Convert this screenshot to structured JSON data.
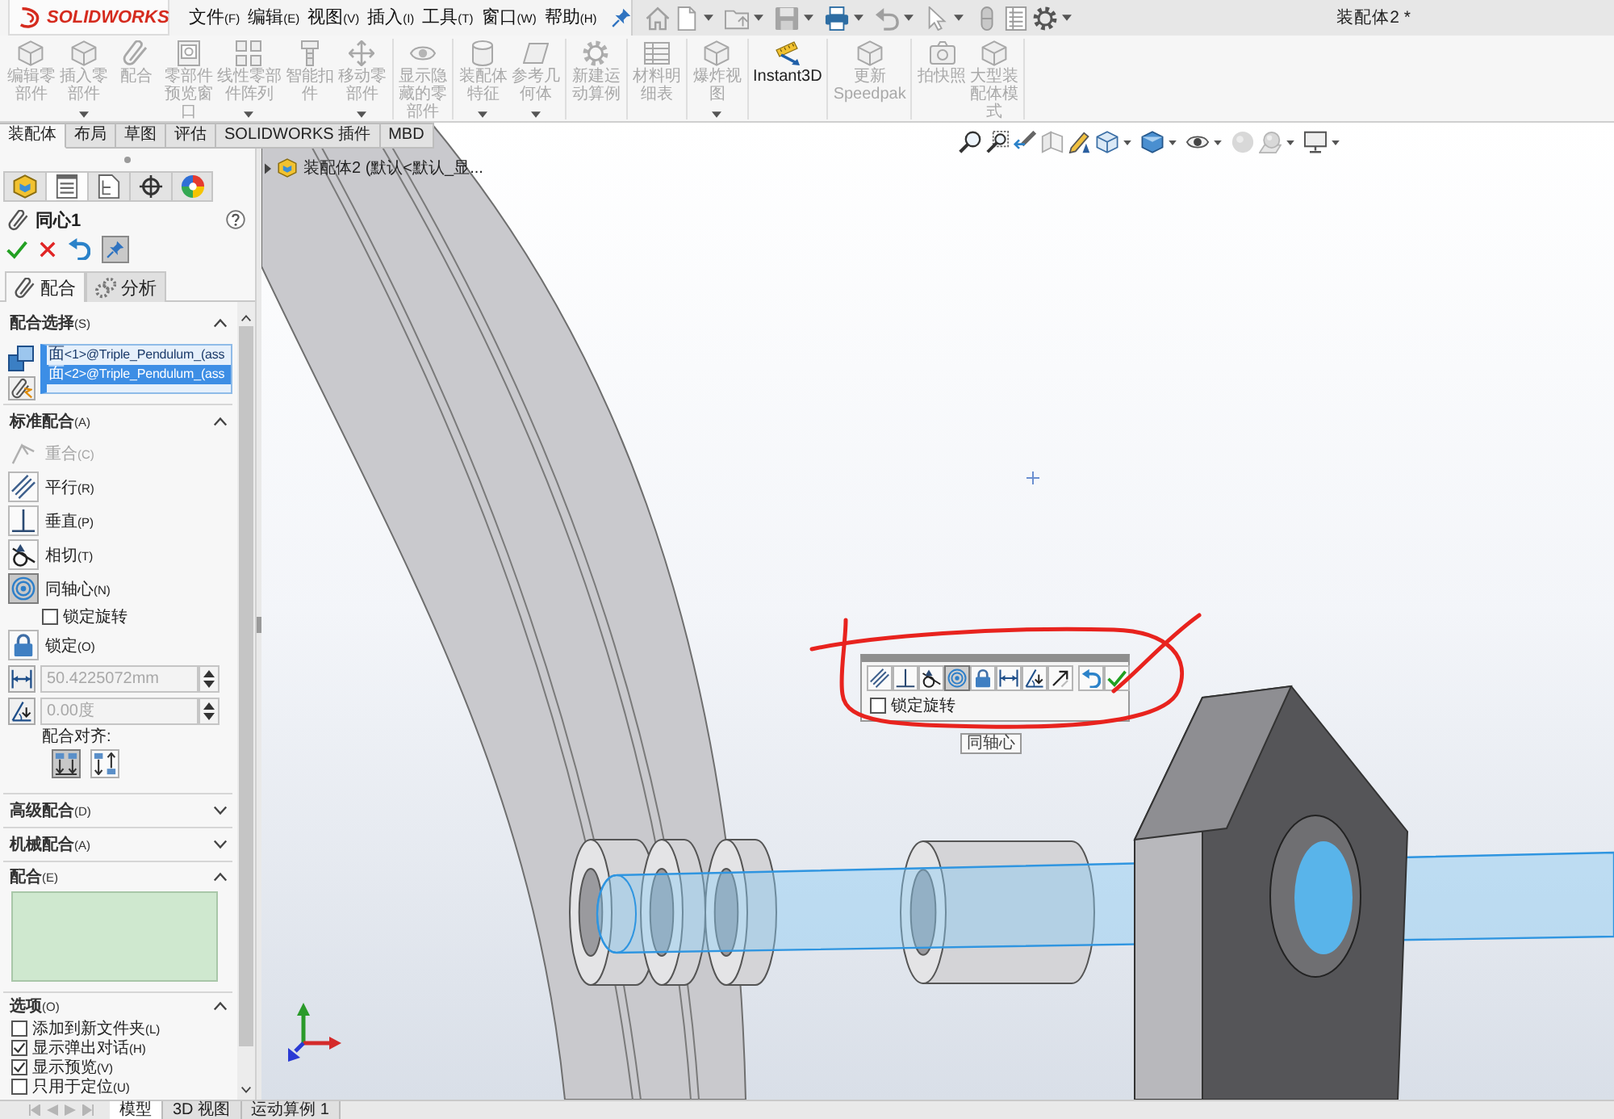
{
  "title_bar": {
    "logo": "SOLIDWORKS",
    "menu": [
      {
        "label": "文件",
        "accel": "(F)"
      },
      {
        "label": "编辑",
        "accel": "(E)"
      },
      {
        "label": "视图",
        "accel": "(V)"
      },
      {
        "label": "插入",
        "accel": "(I)"
      },
      {
        "label": "工具",
        "accel": "(T)"
      },
      {
        "label": "窗口",
        "accel": "(W)"
      },
      {
        "label": "帮助",
        "accel": "(H)"
      }
    ],
    "document_title": "装配体2 *"
  },
  "ribbon": {
    "groups": [
      [
        {
          "label": "编辑零部件",
          "disabled": true,
          "dropdown": false
        },
        {
          "label": "插入零部件",
          "disabled": true,
          "dropdown": true
        },
        {
          "label": "配合",
          "disabled": true,
          "dropdown": false
        },
        {
          "label": "零部件预览窗口",
          "disabled": true,
          "dropdown": false
        },
        {
          "label": "线性零部件阵列",
          "disabled": true,
          "dropdown": true
        },
        {
          "label": "智能扣件",
          "disabled": true,
          "dropdown": false
        },
        {
          "label": "移动零部件",
          "disabled": true,
          "dropdown": true
        }
      ],
      [
        {
          "label": "显示隐藏的零部件",
          "disabled": true,
          "dropdown": false
        }
      ],
      [
        {
          "label": "装配体特征",
          "disabled": true,
          "dropdown": true
        },
        {
          "label": "参考几何体",
          "disabled": true,
          "dropdown": true
        }
      ],
      [
        {
          "label": "新建运动算例",
          "disabled": true,
          "dropdown": false
        }
      ],
      [
        {
          "label": "材料明细表",
          "disabled": true,
          "dropdown": false
        }
      ],
      [
        {
          "label": "爆炸视图",
          "disabled": true,
          "dropdown": true
        }
      ],
      [
        {
          "label": "Instant3D",
          "disabled": false,
          "dropdown": false
        }
      ],
      [
        {
          "label": "更新 Speedpak",
          "disabled": true,
          "dropdown": false
        }
      ],
      [
        {
          "label": "拍快照",
          "disabled": true,
          "dropdown": false
        },
        {
          "label": "大型装配体模式",
          "disabled": true,
          "dropdown": false
        }
      ]
    ]
  },
  "command_tabs": [
    {
      "label": "装配体",
      "selected": true
    },
    {
      "label": "布局",
      "selected": false
    },
    {
      "label": "草图",
      "selected": false
    },
    {
      "label": "评估",
      "selected": false
    },
    {
      "label": "SOLIDWORKS 插件",
      "selected": false
    },
    {
      "label": "MBD",
      "selected": false
    }
  ],
  "panel_tabs": [
    {
      "selected": false
    },
    {
      "selected": true
    },
    {
      "selected": false
    },
    {
      "selected": false
    },
    {
      "selected": false
    }
  ],
  "property_manager": {
    "title": "同心1",
    "pinned": true,
    "tabs": [
      {
        "label": "配合",
        "selected": true
      },
      {
        "label": "分析",
        "selected": false
      }
    ],
    "sections": [
      {
        "kind": "selection",
        "title": "配合选择",
        "accel": "(S)",
        "expanded": true,
        "items": [
          {
            "text": "面<1>@Triple_Pendulum_(ass",
            "selected": false
          },
          {
            "text": "面<2>@Triple_Pendulum_(ass",
            "selected": true
          }
        ]
      },
      {
        "kind": "standard",
        "title": "标准配合",
        "accel": "(A)",
        "expanded": true,
        "items": [
          {
            "kind": "mate",
            "label": "重合",
            "accel": "(C)",
            "selected": false,
            "disabled": true
          },
          {
            "kind": "mate",
            "label": "平行",
            "accel": "(R)",
            "selected": false,
            "disabled": false
          },
          {
            "kind": "mate",
            "label": "垂直",
            "accel": "(P)",
            "selected": false,
            "disabled": false
          },
          {
            "kind": "mate",
            "label": "相切",
            "accel": "(T)",
            "selected": false,
            "disabled": false
          },
          {
            "kind": "mate",
            "label": "同轴心",
            "accel": "(N)",
            "selected": true,
            "disabled": false
          },
          {
            "kind": "checkbox",
            "label": "锁定旋转",
            "checked": false
          },
          {
            "kind": "mate",
            "label": "锁定",
            "accel": "(O)",
            "selected": false,
            "disabled": false
          },
          {
            "kind": "distance",
            "value": "50.4225072mm",
            "disabled": true
          },
          {
            "kind": "angle",
            "value": "0.00度",
            "disabled": true
          },
          {
            "kind": "align",
            "label": "配合对齐:",
            "options": [
              {
                "selected": true
              },
              {
                "selected": false
              }
            ]
          }
        ]
      },
      {
        "kind": "group",
        "title": "高级配合",
        "accel": "(D)",
        "expanded": false
      },
      {
        "kind": "group",
        "title": "机械配合",
        "accel": "(A)",
        "expanded": false
      },
      {
        "kind": "list",
        "title": "配合",
        "accel": "(E)",
        "expanded": true
      },
      {
        "kind": "options",
        "title": "选项",
        "accel": "(O)",
        "expanded": true,
        "items": [
          {
            "label": "添加到新文件夹",
            "accel": "(L)",
            "checked": false
          },
          {
            "label": "显示弹出对话",
            "accel": "(H)",
            "checked": true
          },
          {
            "label": "显示预览",
            "accel": "(V)",
            "checked": true
          },
          {
            "label": "只用于定位",
            "accel": "(U)",
            "checked": false
          }
        ]
      }
    ]
  },
  "viewport": {
    "tree": {
      "label": "装配体2 (默认<默认_显...",
      "expanded": false
    },
    "popup": {
      "buttons": [
        {
          "selected": false
        },
        {
          "selected": false
        },
        {
          "selected": false
        },
        {
          "selected": true
        },
        {
          "selected": false
        },
        {
          "selected": false
        },
        {
          "selected": false
        },
        {
          "selected": false
        },
        {
          "selected": false
        },
        {
          "selected": false
        }
      ],
      "checkbox": {
        "label": "锁定旋转",
        "checked": false
      }
    },
    "tooltip": "同轴心"
  },
  "bottom_tabs": [
    {
      "label": "模型",
      "selected": true
    },
    {
      "label": "3D 视图",
      "selected": false
    },
    {
      "label": "运动算例 1",
      "selected": false
    }
  ]
}
